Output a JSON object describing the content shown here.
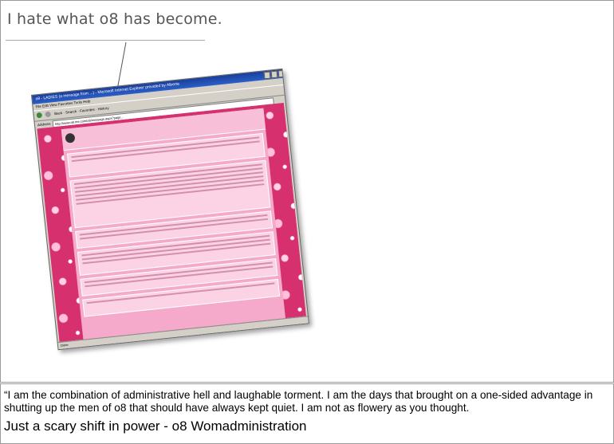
{
  "caption": "I hate what o8 has become.",
  "browser": {
    "title": "o8 - LADIES (a message from ...) - Microsoft Internet Explorer provided by Alberta",
    "menu": "File   Edit   View   Favorites   Tools   Help",
    "toolbar": "Back  ·  Search  ·  Favorites  ·  History",
    "address_label": "Address",
    "address": "http://www.o8.me.com/o8/message.aspx?page...",
    "status": "Done"
  },
  "quote": {
    "text": "“I am the combination of administrative hell and laughable torment. I am the days that brought on a one-sided advantage in shutting up the men of o8 that should have always kept quiet. I am not as flowery as you thought.",
    "signature": "Just a scary shift in power - o8 Womadministration"
  }
}
